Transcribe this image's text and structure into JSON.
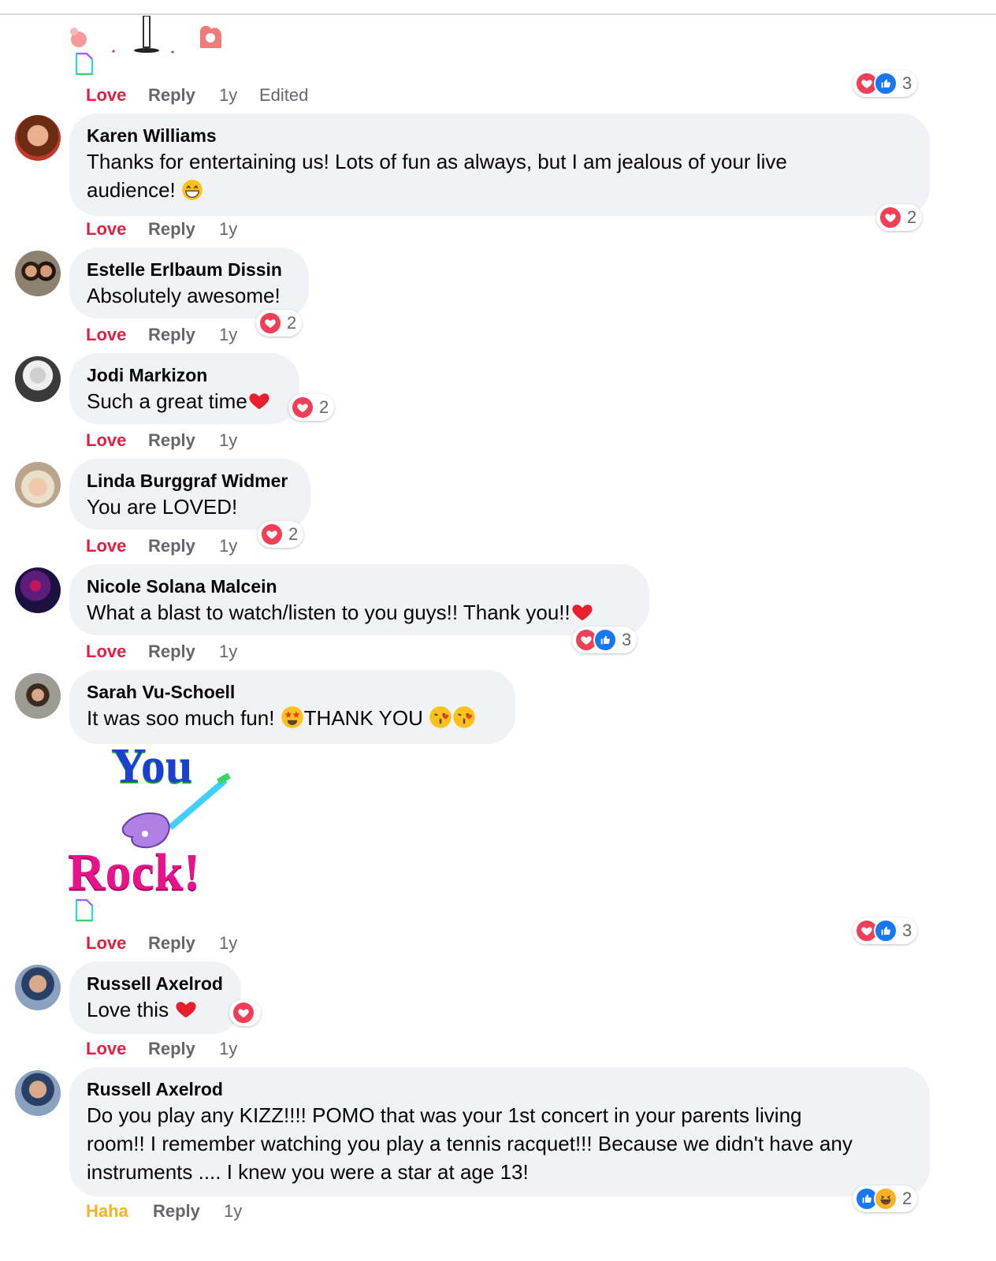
{
  "icons": {
    "heart": "heart-icon",
    "like": "thumbs-up-icon",
    "haha": "laughing-face-icon",
    "grin": "grinning-face-emoji",
    "star_struck": "star-struck-emoji",
    "kiss": "face-blowing-kiss-emoji",
    "broken_image": "broken-image-icon"
  },
  "colors": {
    "love": "#e41e3f",
    "haha": "#f7b125",
    "meta": "#65676b",
    "bubble": "#f0f2f5",
    "heart": "#f33e58",
    "like": "#1877f2"
  },
  "top_comment": {
    "reaction_label": "Love",
    "reply_label": "Reply",
    "time": "1y",
    "edited": "Edited",
    "reaction_count": "3"
  },
  "comments": [
    {
      "author": "Karen Williams",
      "text": "Thanks for entertaining us! Lots of fun as always, but I am jealous of your live",
      "text2": "audience! ",
      "reaction_label": "Love",
      "reply_label": "Reply",
      "time": "1y",
      "reaction_count": "2"
    },
    {
      "author": "Estelle Erlbaum Dissin",
      "text": "Absolutely awesome!",
      "reaction_label": "Love",
      "reply_label": "Reply",
      "time": "1y",
      "reaction_count": "2"
    },
    {
      "author": "Jodi Markizon",
      "text": "Such a great time",
      "reaction_label": "Love",
      "reply_label": "Reply",
      "time": "1y",
      "reaction_count": "2"
    },
    {
      "author": "Linda Burggraf Widmer",
      "text": "You are LOVED!",
      "reaction_label": "Love",
      "reply_label": "Reply",
      "time": "1y",
      "reaction_count": "2"
    },
    {
      "author": "Nicole Solana Malcein",
      "text": "What a blast to watch/listen to you guys!! Thank you!!",
      "reaction_label": "Love",
      "reply_label": "Reply",
      "time": "1y",
      "reaction_count": "3"
    },
    {
      "author": "Sarah Vu-Schoell",
      "text_a": "It was soo much fun! ",
      "text_b": "THANK YOU ",
      "sticker_word1": "You",
      "sticker_word2": "Rock!",
      "reaction_label": "Love",
      "reply_label": "Reply",
      "time": "1y",
      "reaction_count": "3"
    },
    {
      "author": "Russell Axelrod",
      "text": "Love this ",
      "reaction_label": "Love",
      "reply_label": "Reply",
      "time": "1y"
    },
    {
      "author": "Russell Axelrod",
      "lines": [
        "Do you play any KIZZ!!!! POMO that was your 1st concert in your parents living",
        "room!! I remember watching you play a tennis racquet!!! Because we didn't have any",
        "instruments .... I knew you were a star at age 13!"
      ],
      "reaction_label": "Haha",
      "reply_label": "Reply",
      "time": "1y",
      "reaction_count": "2"
    }
  ]
}
